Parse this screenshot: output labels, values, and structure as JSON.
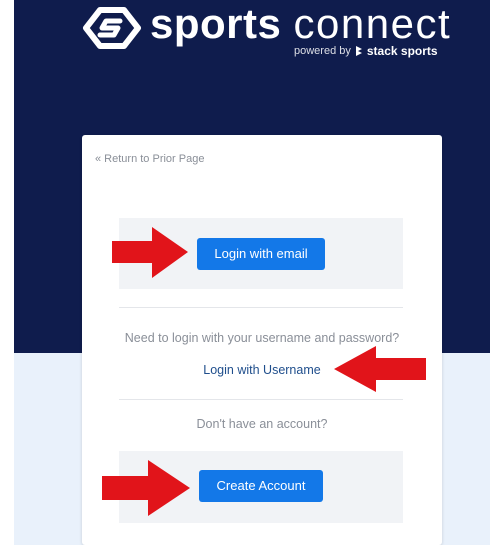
{
  "brand": {
    "name_bold": "sports",
    "name_light": "connect",
    "powered_by": "powered by",
    "partner": "stack sports"
  },
  "colors": {
    "hero_bg": "#0f1c4d",
    "lower_bg": "#e9f1fb",
    "primary_button": "#1378e8",
    "link": "#1f4e8c",
    "annotation_arrow": "#e1141a"
  },
  "card": {
    "back_link": "« Return to Prior Page",
    "login_email_button": "Login with email",
    "username_prompt": "Need to login with your username and password?",
    "login_username_link": "Login with Username",
    "no_account_prompt": "Don't have an account?",
    "create_account_button": "Create Account"
  },
  "annotations": {
    "arrow_icon": "red-arrow-icon"
  }
}
